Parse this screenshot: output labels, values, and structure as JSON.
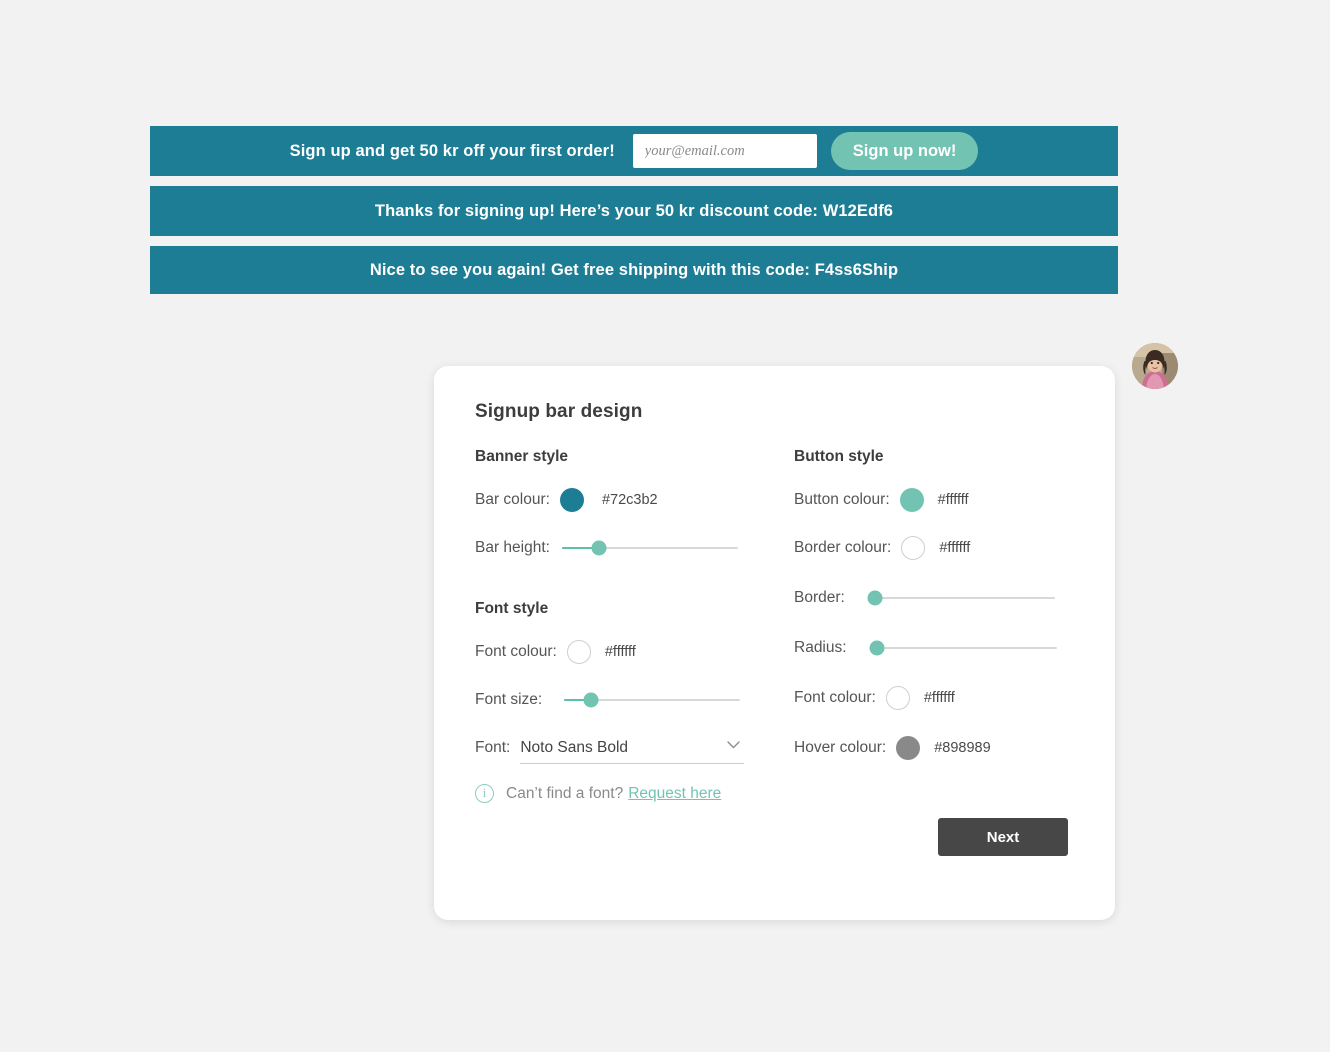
{
  "preview": {
    "bar_colour": "#1d7d95",
    "button_colour": "#72c3b2",
    "banners": [
      {
        "id": "signup-prompt",
        "text": "Sign up and get 50 kr off your first order!",
        "email_placeholder": "your@email.com",
        "email_value": "",
        "button_label": "Sign up now!"
      },
      {
        "id": "thanks-message",
        "text": "Thanks for signing up! Here’s your 50 kr discount code: W12Edf6"
      },
      {
        "id": "returning-message",
        "text": "Nice to see you again! Get free shipping with this code: F4ss6Ship"
      }
    ]
  },
  "avatar": {
    "name": "user-avatar"
  },
  "card": {
    "title": "Signup bar design",
    "next_label": "Next",
    "banner_style": {
      "heading": "Banner style",
      "bar_colour": {
        "label": "Bar colour:",
        "hex": "#72c3b2",
        "swatch": "#1d7d95"
      },
      "bar_height": {
        "label": "Bar height:",
        "percent": 21
      }
    },
    "font_style": {
      "heading": "Font style",
      "font_colour": {
        "label": "Font colour:",
        "hex": "#ffffff",
        "swatch": "#ffffff"
      },
      "font_size": {
        "label": "Font size:",
        "percent": 15
      },
      "font": {
        "label": "Font:",
        "value": "Noto Sans Bold"
      },
      "info_text": "Can’t find a font?",
      "info_link": "Request here",
      "info_icon_glyph": "i"
    },
    "button_style": {
      "heading": "Button style",
      "button_colour": {
        "label": "Button colour:",
        "hex": "#ffffff",
        "swatch": "#72c3b2"
      },
      "border_colour": {
        "label": "Border colour:",
        "hex": "#ffffff",
        "swatch": "#ffffff"
      },
      "border": {
        "label": "Border:",
        "percent": 0
      },
      "radius": {
        "label": "Radius:",
        "percent": 0
      },
      "font_colour": {
        "label": "Font colour:",
        "hex": "#ffffff",
        "swatch": "#ffffff"
      },
      "hover_colour": {
        "label": "Hover colour:",
        "hex": "#898989",
        "swatch": "#898989"
      }
    }
  }
}
